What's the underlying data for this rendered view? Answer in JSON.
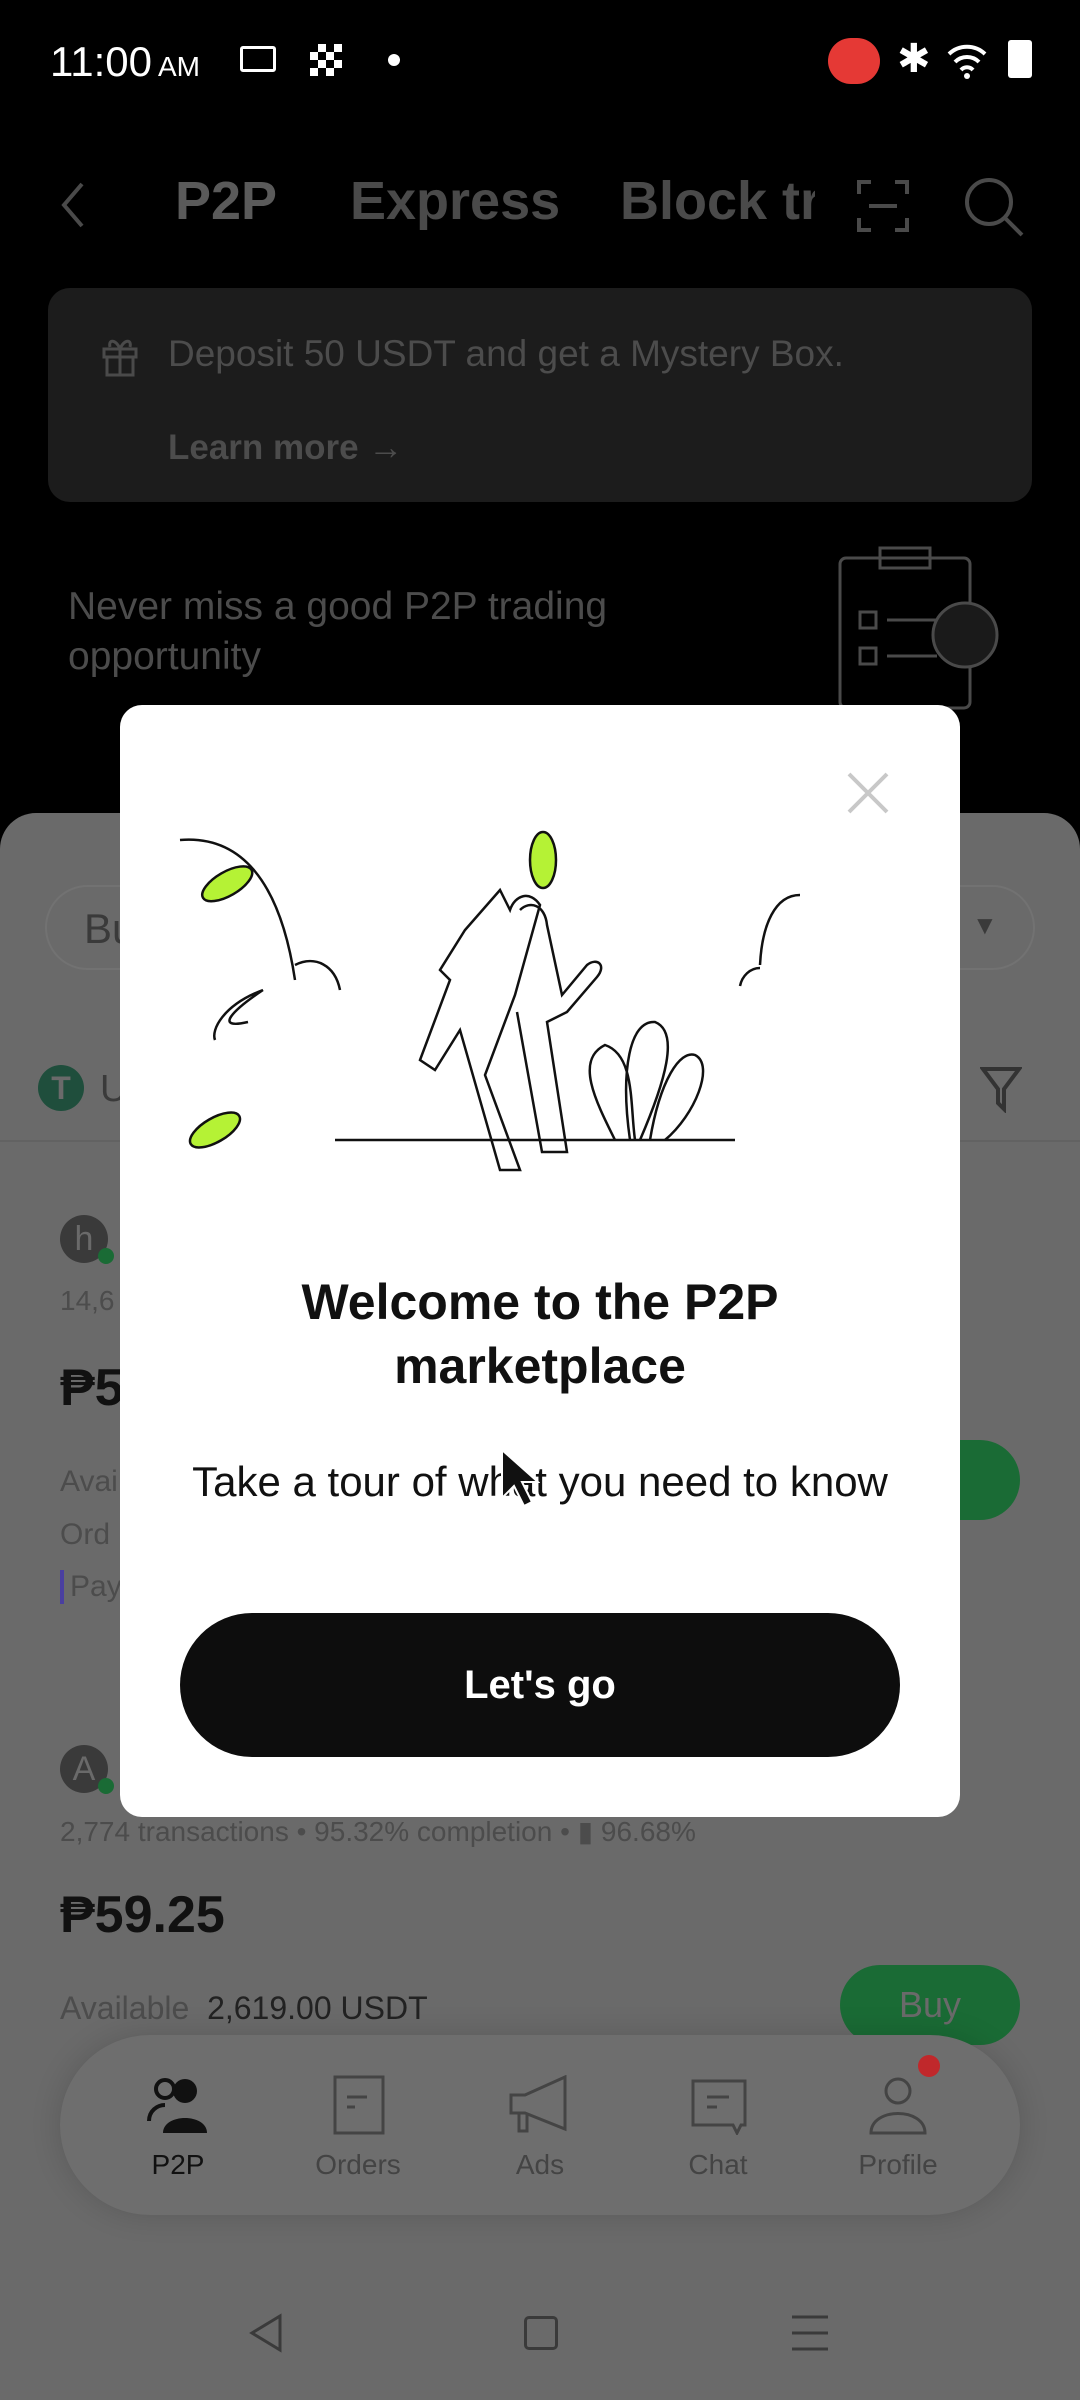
{
  "status_bar": {
    "time": "11:00",
    "ampm": "AM"
  },
  "header": {
    "tabs": [
      {
        "label": "P2P",
        "active": true
      },
      {
        "label": "Express"
      },
      {
        "label": "Block tr"
      }
    ]
  },
  "banner": {
    "text": "Deposit 50 USDT and get a Mystery Box.",
    "link": "Learn more →"
  },
  "promo": {
    "text": "Never miss a good P2P trading opportunity"
  },
  "filters": {
    "side_partial": "Bu",
    "coin_partial": "U"
  },
  "listings": [
    {
      "avatar": "h",
      "stats_partial": "14,6",
      "price_partial": "₱5",
      "available_partial": "Avai",
      "order_partial": "Ord",
      "payment_partial": "Pay"
    },
    {
      "avatar": "A",
      "stats": "2,774 transactions • 95.32% completion •",
      "rating": "96.68%",
      "price": "₱59.25",
      "available_label": "Available",
      "available_value": "2,619.00 USDT",
      "buy": "Buy"
    }
  ],
  "bottom_nav": [
    {
      "label": "P2P",
      "active": true
    },
    {
      "label": "Orders"
    },
    {
      "label": "Ads"
    },
    {
      "label": "Chat"
    },
    {
      "label": "Profile",
      "badge": true
    }
  ],
  "modal": {
    "title": "Welcome to the P2P marketplace",
    "subtitle": "Take a tour of what you need to know",
    "cta": "Let's go"
  },
  "colors": {
    "accent": "#b5f235",
    "buy_dimmed": "#1a6b35",
    "badge": "#c0282b"
  }
}
